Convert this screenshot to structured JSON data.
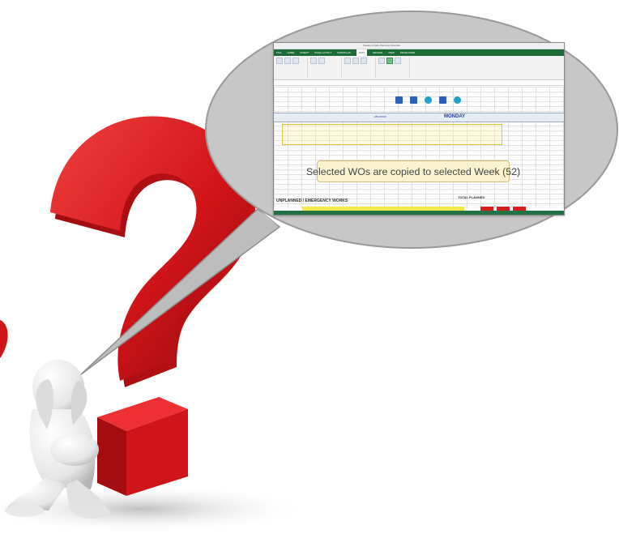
{
  "window": {
    "title": "Weekly & Daily Planning Schedule"
  },
  "ribbon_tabs": [
    "FILE",
    "HOME",
    "INSERT",
    "PAGE LAYOUT",
    "FORMULAS",
    "DATA",
    "REVIEW",
    "VIEW",
    "DEVELOPER"
  ],
  "sheet": {
    "date": "28/12/2016",
    "day": "MONDAY"
  },
  "callout": {
    "message": "Selected WOs are copied to selected Week (52)"
  },
  "section_label": "UNPLANNED / EMERGENCY WORKS",
  "total_label": "TOTAL PLANNED",
  "colors": {
    "question_mark": "#d4161c",
    "bubble": "#c7c7c7",
    "tooltip": "#fbf3cf",
    "excel_green": "#217346"
  },
  "icons": [
    "question-mark-icon",
    "thinking-person-figure",
    "speech-bubble"
  ]
}
